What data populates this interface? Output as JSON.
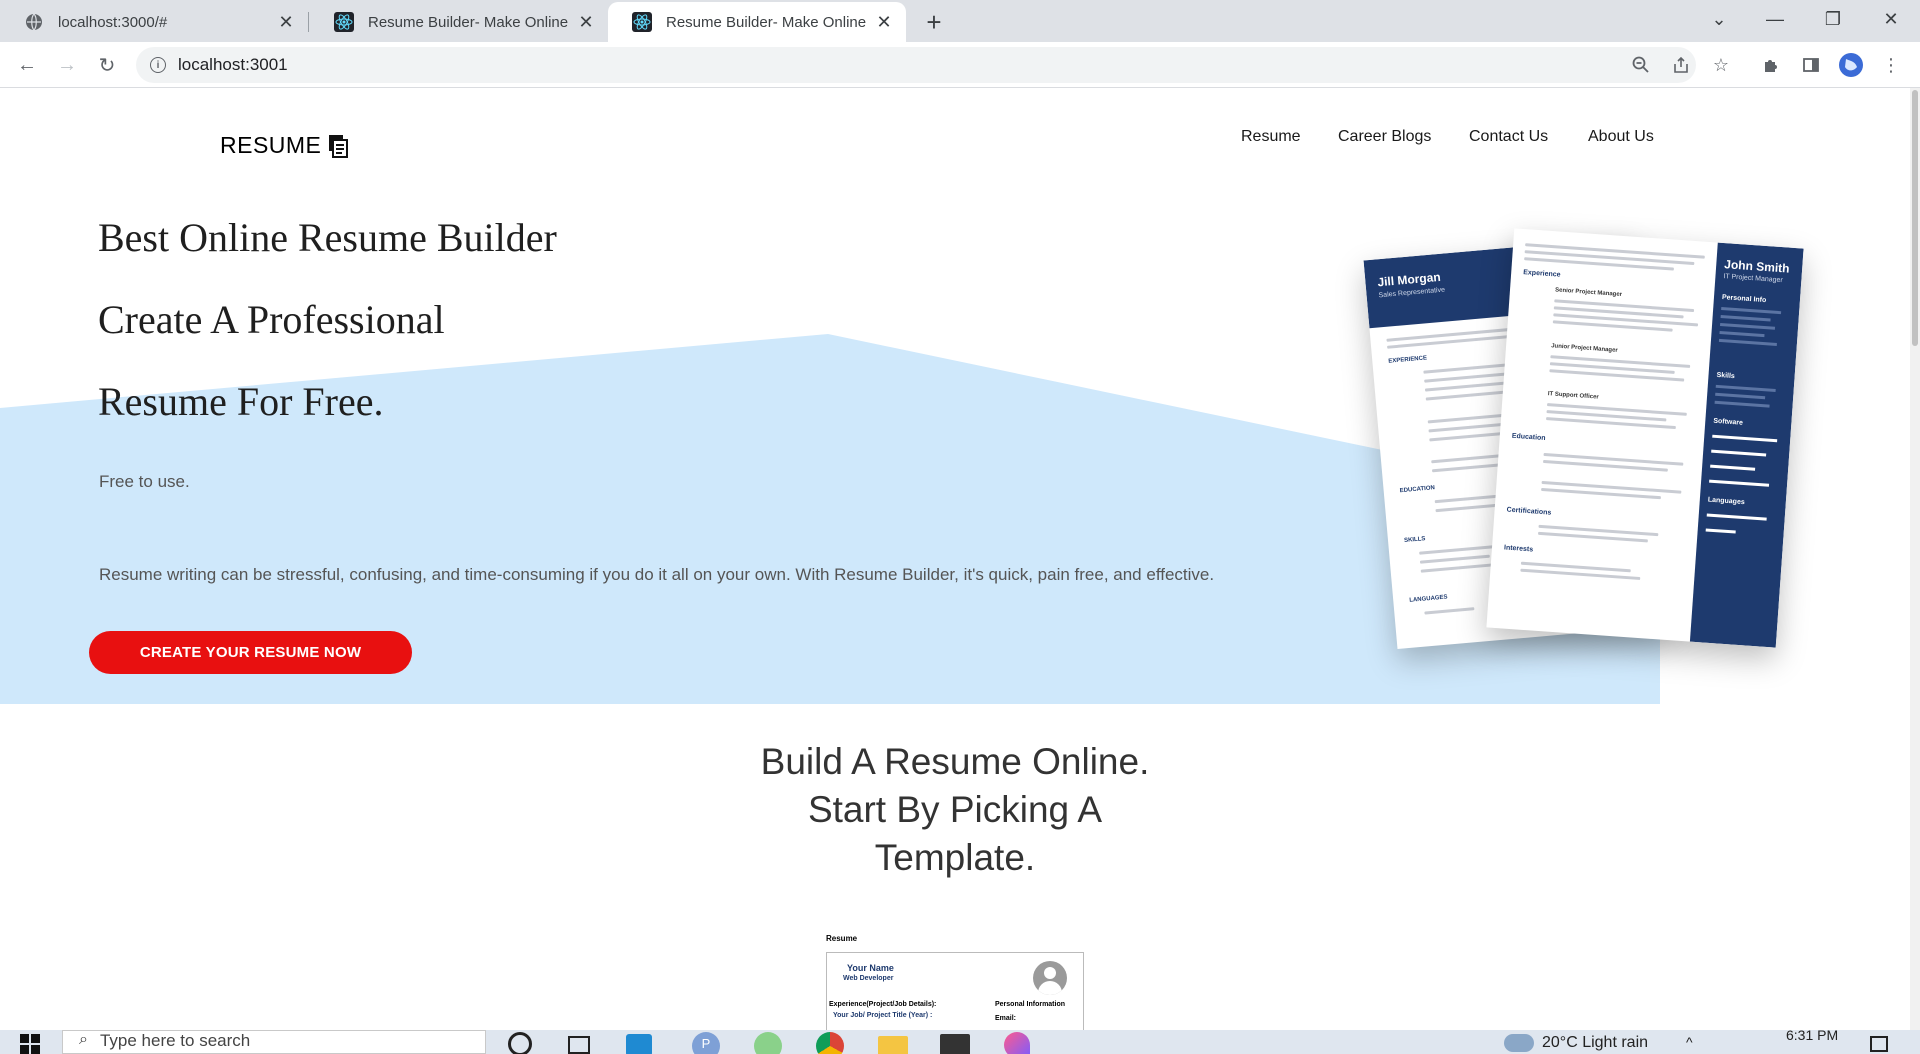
{
  "browser": {
    "tabs": [
      {
        "title": "localhost:3000/#",
        "favicon": "globe-icon",
        "active": false
      },
      {
        "title": "Resume Builder- Make Online Re",
        "favicon": "react-icon",
        "active": false
      },
      {
        "title": "Resume Builder- Make Online Re",
        "favicon": "react-icon",
        "active": true
      }
    ],
    "url": "localhost:3001"
  },
  "header": {
    "logo_text": "RESUME",
    "nav": [
      "Resume",
      "Career Blogs",
      "Contact Us",
      "About Us"
    ]
  },
  "hero": {
    "title_lines": [
      "Best Online Resume Builder",
      "Create A Professional",
      "Resume For Free."
    ],
    "tagline": "Free to use.",
    "description": "Resume writing can be stressful, confusing, and time-consuming if you do it all on your own. With Resume Builder, it's quick, pain free, and effective.",
    "cta_label": "CREATE YOUR RESUME NOW",
    "colors": {
      "band": "#cfe8fb",
      "cta": "#e81010",
      "resume_navy": "#1e3a6e"
    }
  },
  "resume_preview_left": {
    "name": "Jill Morgan",
    "role": "Sales Representative",
    "sections": [
      "EXPERIENCE",
      "EDUCATION",
      "SKILLS",
      "LANGUAGES"
    ]
  },
  "resume_preview_right": {
    "name": "John Smith",
    "role": "IT Project Manager",
    "sidebar_sections": [
      "Personal Info",
      "Skills",
      "Software",
      "Languages"
    ],
    "main_sections": [
      "Experience",
      "Education",
      "Certifications",
      "Interests"
    ],
    "jobs": [
      "Senior Project Manager",
      "Junior Project Manager",
      "IT Support Officer"
    ]
  },
  "section_templates": {
    "heading_lines": [
      "Build A Resume Online.",
      "Start By Picking A",
      "Template."
    ],
    "template_card": {
      "label": "Resume",
      "name": "Your Name",
      "role": "Web Developer",
      "left_heading": "Experience(Project/Job Details):",
      "left_sub": "Your Job/ Project Title (Year) :",
      "right_heading": "Personal Information",
      "right_sub": "Email:"
    }
  },
  "taskbar": {
    "search_placeholder": "Type here to search",
    "weather": "20°C  Light rain",
    "time": "6:31 PM"
  }
}
